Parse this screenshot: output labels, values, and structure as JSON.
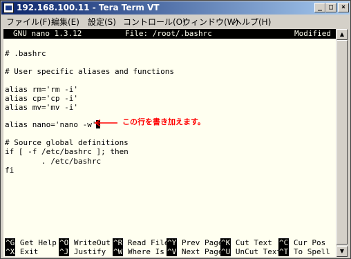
{
  "window": {
    "title": "192.168.100.11 - Tera Term VT",
    "minimize_label": "_",
    "maximize_label": "□",
    "close_label": "×"
  },
  "menu": [
    "ファイル(F)",
    "編集(E)",
    "設定(S)",
    "コントロール(O)",
    "ウィンドウ(W)",
    "ヘルプ(H)"
  ],
  "nano": {
    "version": "GNU nano 1.3.12",
    "file": "File: /root/.bashrc",
    "status": "Modified"
  },
  "lines": [
    "# .bashrc",
    "",
    "# User specific aliases and functions",
    "",
    "alias rm='rm -i'",
    "alias cp='cp -i'",
    "alias mv='mv -i'",
    "",
    "alias nano='nano -w'",
    "",
    "# Source global definitions",
    "if [ -f /etc/bashrc ]; then",
    "        . /etc/bashrc",
    "fi"
  ],
  "annotation": "この行を書き加えます。",
  "shortcuts_row1": [
    {
      "key": "^G",
      "label": "Get Help"
    },
    {
      "key": "^O",
      "label": "WriteOut"
    },
    {
      "key": "^R",
      "label": "Read File"
    },
    {
      "key": "^Y",
      "label": "Prev Page"
    },
    {
      "key": "^K",
      "label": "Cut Text"
    },
    {
      "key": "^C",
      "label": "Cur Pos"
    }
  ],
  "shortcuts_row2": [
    {
      "key": "^X",
      "label": "Exit"
    },
    {
      "key": "^J",
      "label": "Justify"
    },
    {
      "key": "^W",
      "label": "Where Is"
    },
    {
      "key": "^V",
      "label": "Next Page"
    },
    {
      "key": "^U",
      "label": "UnCut Text"
    },
    {
      "key": "^T",
      "label": "To Spell"
    }
  ],
  "colors": {
    "terminal_bg": "#fffff0",
    "annotation": "#ff0000"
  }
}
